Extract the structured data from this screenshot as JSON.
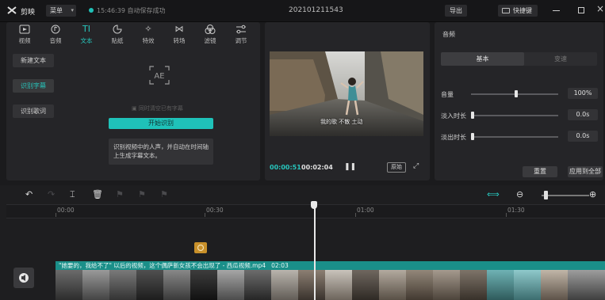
{
  "app": {
    "name": "剪映",
    "menu_label": "菜单",
    "save_status": "15:46:39 自动保存成功",
    "project_title": "202101211543",
    "export_label": "导出",
    "shortcut_label": "快捷键",
    "accent": "#1fc2b9"
  },
  "media_tabs": [
    {
      "label": "视频",
      "icon": "video-icon"
    },
    {
      "label": "音频",
      "icon": "audio-icon"
    },
    {
      "label": "文本",
      "icon": "text-icon",
      "active": true
    },
    {
      "label": "贴纸",
      "icon": "sticker-icon"
    },
    {
      "label": "特效",
      "icon": "effects-icon"
    },
    {
      "label": "转场",
      "icon": "transition-icon"
    },
    {
      "label": "滤镜",
      "icon": "filter-icon"
    },
    {
      "label": "调节",
      "icon": "adjust-icon"
    }
  ],
  "text_sidebar": [
    "新建文本",
    "识别字幕",
    "识别歌词"
  ],
  "recognize": {
    "scan_icon": "AE",
    "hint": "同时清空已有字幕",
    "start_label": "开始识别",
    "info": "识别视频中的人声，并自动在时间轴上生成字幕文本。"
  },
  "player": {
    "subtitle": "我的歌 不散 土动",
    "current_time": "00:00:51",
    "total_time": "00:02:04",
    "original_label": "原始"
  },
  "properties": {
    "title": "音频",
    "tabs": [
      "基本",
      "变速"
    ],
    "rows": [
      {
        "label": "音量",
        "value": "100%",
        "level": 0.52
      },
      {
        "label": "淡入时长",
        "value": "0.0s",
        "level": 0
      },
      {
        "label": "淡出时长",
        "value": "0.0s",
        "level": 0
      }
    ],
    "reset_label": "重置",
    "apply_all_label": "应用到全部"
  },
  "timeline": {
    "ruler": [
      "00:00",
      "00:30",
      "01:00",
      "01:30"
    ],
    "clip_title": "\"她要的，我给不了\" 以后的视频，这个偶萨新女孩不会出现了 - 西瓜视频.mp4",
    "clip_duration": "02:03",
    "zoom_level": 0.05
  }
}
